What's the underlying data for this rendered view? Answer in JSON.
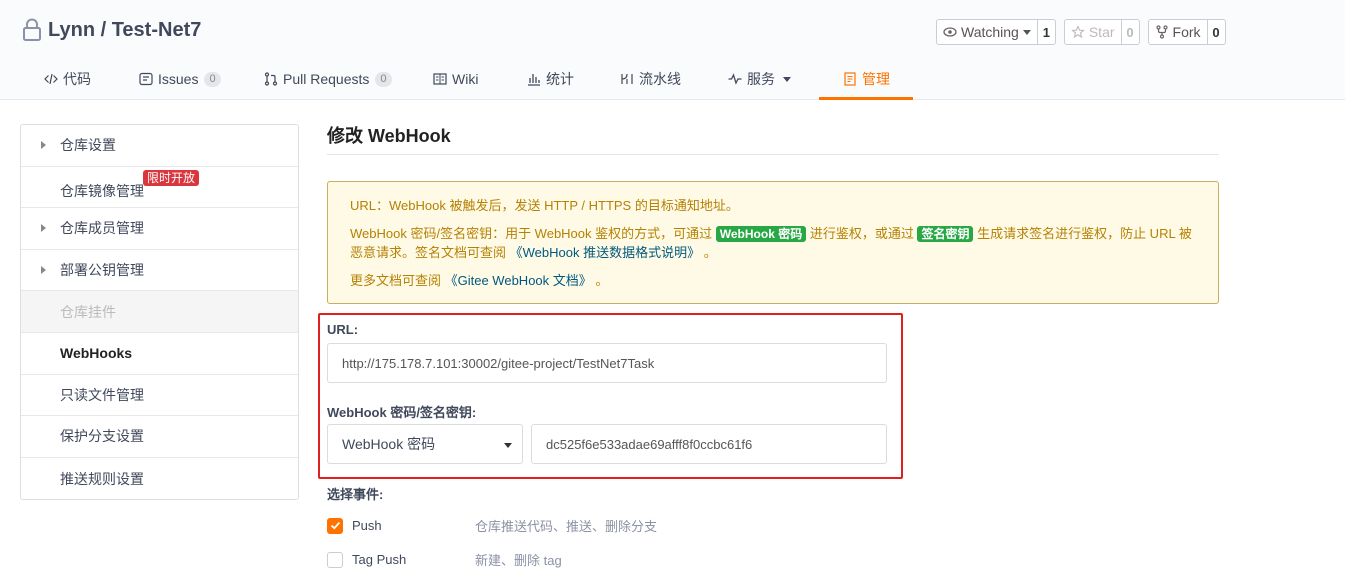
{
  "repo": {
    "title": "Lynn / Test-Net7",
    "watch": {
      "label": "Watching",
      "count": "1"
    },
    "star": {
      "label": "Star",
      "count": "0"
    },
    "fork": {
      "label": "Fork",
      "count": "0"
    }
  },
  "tabs": [
    {
      "label": "代码",
      "icon": "code-icon"
    },
    {
      "label": "Issues",
      "badge": "0",
      "icon": "issues-icon"
    },
    {
      "label": "Pull Requests",
      "badge": "0",
      "icon": "pull-request-icon"
    },
    {
      "label": "Wiki",
      "icon": "wiki-icon"
    },
    {
      "label": "统计",
      "icon": "stats-icon"
    },
    {
      "label": "流水线",
      "icon": "pipeline-icon"
    },
    {
      "label": "服务",
      "icon": "pulse-icon"
    },
    {
      "label": "管理",
      "icon": "manage-icon",
      "active": true
    }
  ],
  "sidebar": {
    "items": [
      {
        "label": "仓库设置",
        "expandable": true
      },
      {
        "label": "仓库镜像管理",
        "badge": "限时开放"
      },
      {
        "label": "仓库成员管理",
        "expandable": true
      },
      {
        "label": "部署公钥管理",
        "expandable": true
      },
      {
        "label": "仓库挂件",
        "disabled": true
      },
      {
        "label": "WebHooks",
        "active": true
      },
      {
        "label": "只读文件管理"
      },
      {
        "label": "保护分支设置"
      },
      {
        "label": "推送规则设置"
      }
    ]
  },
  "main": {
    "title": "修改 WebHook",
    "notice": {
      "line1": "URL：WebHook 被触发后，发送 HTTP / HTTPS 的目标通知地址。",
      "line2_a": "WebHook 密码/签名密钥：用于 WebHook 鉴权的方式，可通过 ",
      "tag1": "WebHook 密码",
      "line2_b": " 进行鉴权，或通过 ",
      "tag2": "签名密钥",
      "line2_c": " 生成请求签名进行鉴权，防止 URL 被恶意请求。签名文档可查阅 ",
      "link1": "《WebHook 推送数据格式说明》",
      "line2_d": " 。",
      "line3_a": "更多文档可查阅 ",
      "link2": "《Gitee WebHook 文档》",
      "line3_b": " 。"
    },
    "url_label": "URL:",
    "url_value": "http://175.178.7.101:30002/gitee-project/TestNet7Task",
    "secret_label": "WebHook 密码/签名密钥:",
    "secret_type": "WebHook 密码",
    "secret_value": "dc525f6e533adae69afff8f0ccbc61f6",
    "events_label": "选择事件:",
    "events": [
      {
        "name": "Push",
        "desc": "仓库推送代码、推送、删除分支",
        "checked": true
      },
      {
        "name": "Tag Push",
        "desc": "新建、删除 tag",
        "checked": false
      }
    ]
  },
  "colors": {
    "accent": "#fe7300",
    "notice_bg": "#fffae5",
    "highlight": "#e02020",
    "badge_red": "#d9363e",
    "tag_green": "#28a745"
  }
}
